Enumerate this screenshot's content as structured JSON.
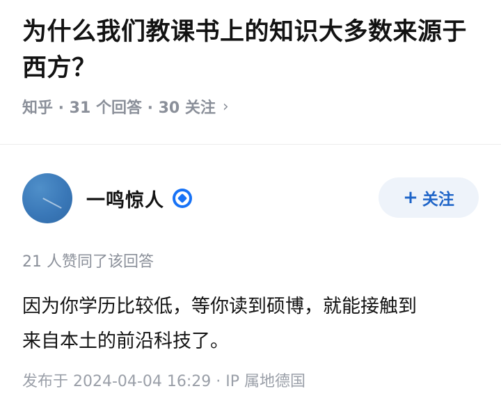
{
  "question": {
    "title": "为什么我们教课书上的知识大多数来源于西方？",
    "meta": "知乎 · 31 个回答 · 30 关注",
    "chevron_icon": "chevron-right-icon"
  },
  "answer": {
    "author": {
      "name": "一鸣惊人",
      "avatar_color": "#3a78b8",
      "verified_icon": "verified-badge-icon",
      "verified_color": "#1772f6"
    },
    "follow_button": {
      "icon": "plus-icon",
      "label": "关注",
      "text_color": "#1e64c8",
      "background": "#eef3fa"
    },
    "likes_text": "21 人赞同了该回答",
    "content": [
      "因为你学历比较低，等你读到硕博，就能接触到",
      "来自本土的前沿科技了。"
    ],
    "published": "发布于 2024-04-04 16:29 · IP 属地德国"
  }
}
